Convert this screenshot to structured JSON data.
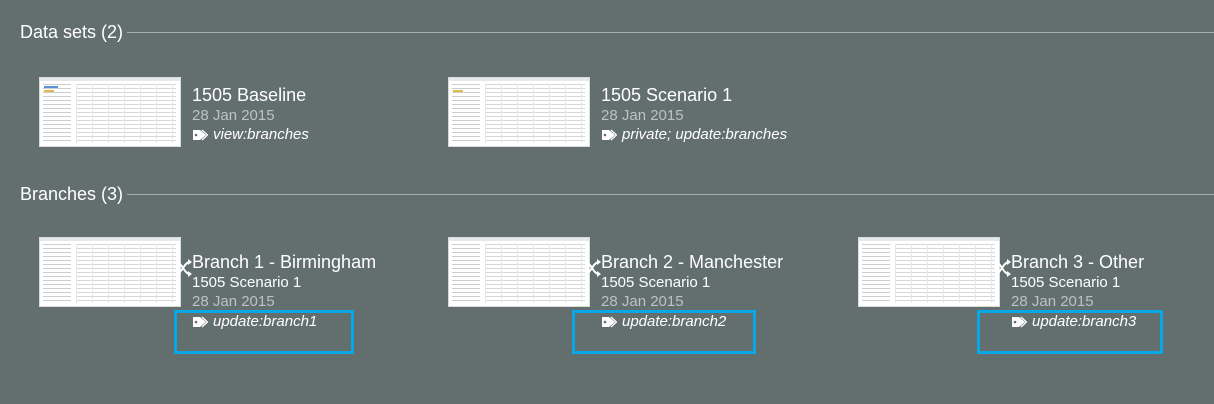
{
  "datasets_section": {
    "title": "Data sets (2)",
    "items": [
      {
        "name": "1505 Baseline",
        "date": "28 Jan 2015",
        "permissions": "view:branches"
      },
      {
        "name": "1505 Scenario 1",
        "date": "28 Jan 2015",
        "permissions": "private; update:branches"
      }
    ]
  },
  "branches_section": {
    "title": "Branches (3)",
    "items": [
      {
        "name": "Branch 1 - Birmingham",
        "source": "1505 Scenario 1",
        "date": "28 Jan 2015",
        "permissions": "update:branch1"
      },
      {
        "name": "Branch 2 - Manchester",
        "source": "1505 Scenario 1",
        "date": "28 Jan 2015",
        "permissions": "update:branch2"
      },
      {
        "name": "Branch 3 - Other",
        "source": "1505 Scenario 1",
        "date": "28 Jan 2015",
        "permissions": "update:branch3"
      }
    ]
  },
  "colors": {
    "background": "#626f6e",
    "highlight": "#0aa7e6",
    "date_text": "#bcc3c2"
  },
  "icons": {
    "permission": "tag-icon",
    "branch": "branch-icon"
  }
}
